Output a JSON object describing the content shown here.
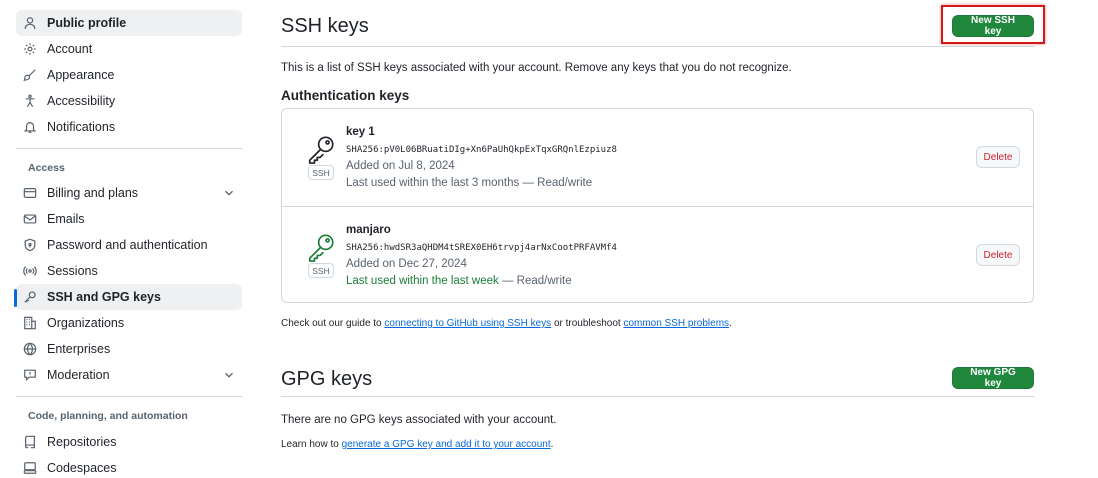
{
  "sidebar": {
    "items": [
      {
        "label": "Public profile",
        "icon": "person-icon"
      },
      {
        "label": "Account",
        "icon": "gear-icon"
      },
      {
        "label": "Appearance",
        "icon": "paintbrush-icon"
      },
      {
        "label": "Accessibility",
        "icon": "accessibility-icon"
      },
      {
        "label": "Notifications",
        "icon": "bell-icon"
      }
    ],
    "access_heading": "Access",
    "access_items": [
      {
        "label": "Billing and plans",
        "icon": "credit-card-icon"
      },
      {
        "label": "Emails",
        "icon": "mail-icon"
      },
      {
        "label": "Password and authentication",
        "icon": "shield-lock-icon"
      },
      {
        "label": "Sessions",
        "icon": "broadcast-icon"
      },
      {
        "label": "SSH and GPG keys",
        "icon": "key-icon"
      },
      {
        "label": "Organizations",
        "icon": "organization-icon"
      },
      {
        "label": "Enterprises",
        "icon": "globe-icon"
      },
      {
        "label": "Moderation",
        "icon": "report-icon"
      }
    ],
    "code_heading": "Code, planning, and automation",
    "code_items": [
      {
        "label": "Repositories",
        "icon": "repo-icon"
      },
      {
        "label": "Codespaces",
        "icon": "codespaces-icon"
      }
    ]
  },
  "ssh": {
    "title": "SSH keys",
    "new_button": "New SSH key",
    "description": "This is a list of SSH keys associated with your account. Remove any keys that you do not recognize.",
    "auth_heading": "Authentication keys",
    "badge": "SSH",
    "delete_label": "Delete",
    "keys": [
      {
        "name": "key 1",
        "fingerprint": "SHA256:pV0L06BRuatiDIg+Xn6PaUhQkpExTqxGRQnlEzpiuz8",
        "added": "Added on Jul 8, 2024",
        "last_used": "Last used within the last 3 months",
        "access": " — Read/write",
        "color": "#1f2328"
      },
      {
        "name": "manjaro",
        "fingerprint": "SHA256:hwdSR3aQHDM4tSREX0EH6trvpj4arNxCootPRFAVMf4",
        "added": "Added on Dec 27, 2024",
        "last_used": "Last used within the last week",
        "access": " — Read/write",
        "color": "#1a7f37"
      }
    ],
    "guide_prefix": "Check out our guide to ",
    "guide_link": "connecting to GitHub using SSH keys",
    "guide_middle": " or troubleshoot ",
    "guide_link2": "common SSH problems",
    "guide_suffix": "."
  },
  "gpg": {
    "title": "GPG keys",
    "new_button": "New GPG key",
    "empty_text": "There are no GPG keys associated with your account.",
    "learn_prefix": "Learn how to ",
    "learn_link": "generate a GPG key and add it to your account",
    "learn_suffix": "."
  }
}
